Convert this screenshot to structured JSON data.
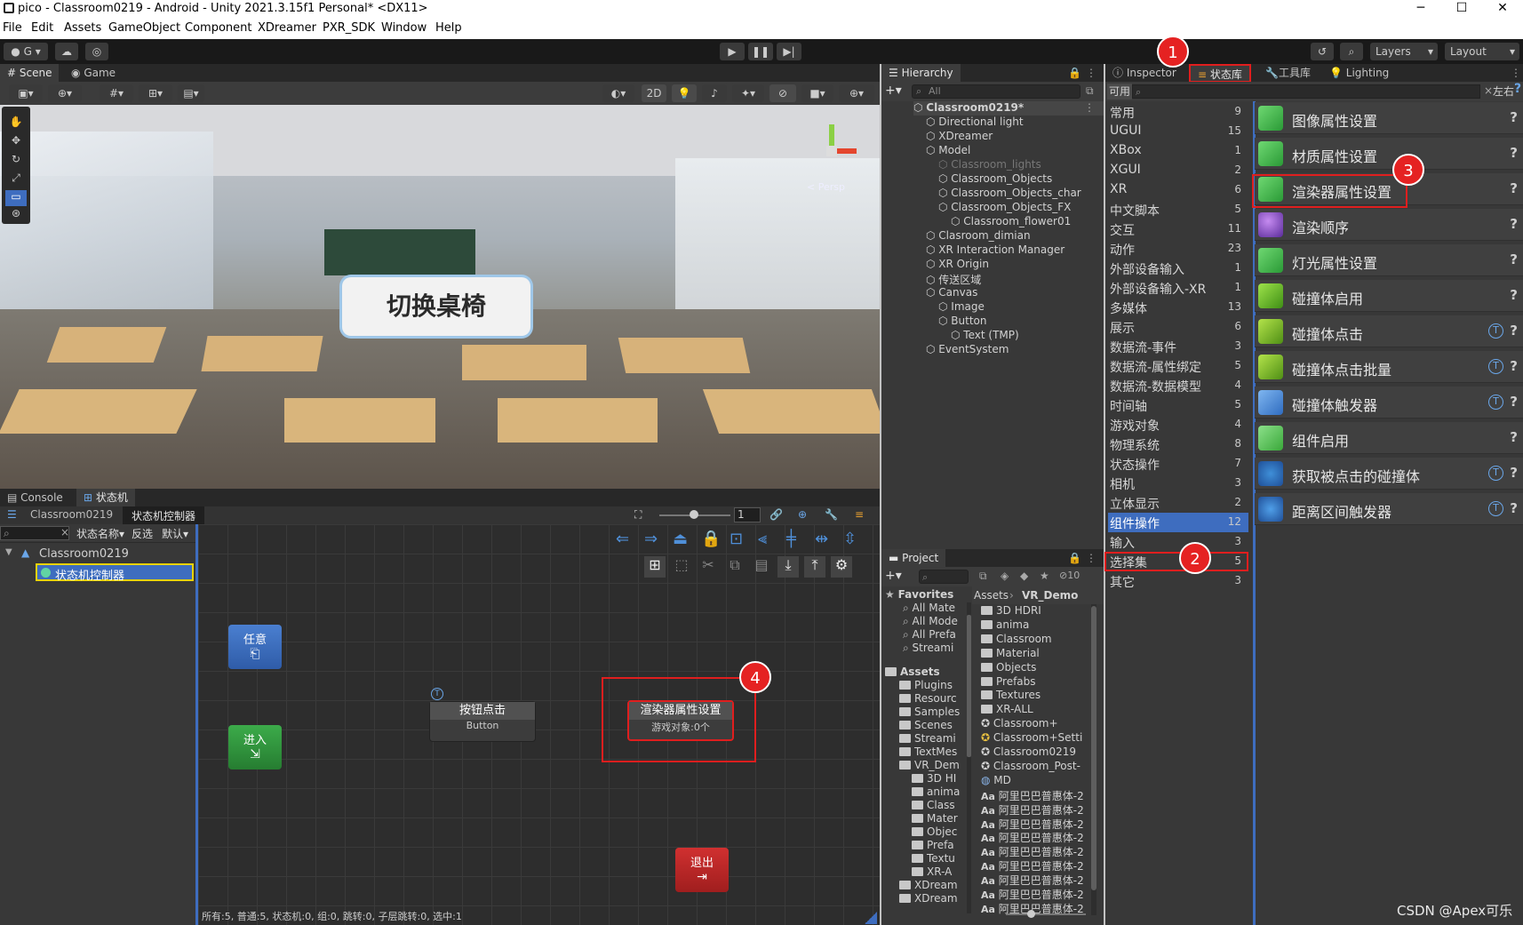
{
  "window": {
    "title": "pico - Classroom0219 - Android - Unity 2021.3.15f1 Personal* <DX11>",
    "minimize": "─",
    "maximize": "☐",
    "close": "✕"
  },
  "menu": [
    "File",
    "Edit",
    "Assets",
    "GameObject",
    "Component",
    "XDreamer",
    "PXR_SDK",
    "Window",
    "Help"
  ],
  "toolbar": {
    "account": "G",
    "layers": "Layers",
    "layout": "Layout"
  },
  "scene": {
    "tab_scene": "Scene",
    "tab_game": "Game",
    "mode_2d": "2D",
    "persp": "< Persp",
    "world_button": "切换桌椅"
  },
  "hierarchy": {
    "tab": "Hierarchy",
    "search_placeholder": "All",
    "items": [
      {
        "label": "Classroom0219*",
        "depth": 0,
        "bold": true
      },
      {
        "label": "Directional light",
        "depth": 1
      },
      {
        "label": "XDreamer",
        "depth": 1
      },
      {
        "label": "Model",
        "depth": 1
      },
      {
        "label": "Classroom_lights",
        "depth": 2,
        "dim": true
      },
      {
        "label": "Classroom_Objects",
        "depth": 2
      },
      {
        "label": "Classroom_Objects_char",
        "depth": 2
      },
      {
        "label": "Classroom_Objects_FX",
        "depth": 2
      },
      {
        "label": "Classroom_flower01",
        "depth": 3
      },
      {
        "label": "Clasroom_dimian",
        "depth": 1
      },
      {
        "label": "XR Interaction Manager",
        "depth": 1
      },
      {
        "label": "XR Origin",
        "depth": 1
      },
      {
        "label": "传送区域",
        "depth": 1
      },
      {
        "label": "Canvas",
        "depth": 1
      },
      {
        "label": "Image",
        "depth": 2
      },
      {
        "label": "Button",
        "depth": 2
      },
      {
        "label": "Text (TMP)",
        "depth": 3
      },
      {
        "label": "EventSystem",
        "depth": 1
      }
    ]
  },
  "inspector": {
    "tab_inspector": "Inspector",
    "tab_statelib": "状态库",
    "tab_tools": "工具库",
    "tab_lighting": "Lighting",
    "filter_label": "可用",
    "layout_label": "左右",
    "categories": [
      {
        "label": "常用",
        "count": "9"
      },
      {
        "label": "UGUI",
        "count": "15"
      },
      {
        "label": "XBox",
        "count": "1"
      },
      {
        "label": "XGUI",
        "count": "2"
      },
      {
        "label": "XR",
        "count": "6"
      },
      {
        "label": "中文脚本",
        "count": "5"
      },
      {
        "label": "交互",
        "count": "11"
      },
      {
        "label": "动作",
        "count": "23"
      },
      {
        "label": "外部设备输入",
        "count": "1"
      },
      {
        "label": "外部设备输入-XR",
        "count": "1"
      },
      {
        "label": "多媒体",
        "count": "13"
      },
      {
        "label": "展示",
        "count": "6"
      },
      {
        "label": "数据流-事件",
        "count": "3"
      },
      {
        "label": "数据流-属性绑定",
        "count": "5"
      },
      {
        "label": "数据流-数据模型",
        "count": "4"
      },
      {
        "label": "时间轴",
        "count": "5"
      },
      {
        "label": "游戏对象",
        "count": "4"
      },
      {
        "label": "物理系统",
        "count": "8"
      },
      {
        "label": "状态操作",
        "count": "7"
      },
      {
        "label": "相机",
        "count": "3"
      },
      {
        "label": "立体显示",
        "count": "2"
      },
      {
        "label": "组件操作",
        "count": "12",
        "selected": true
      },
      {
        "label": "输入",
        "count": "3"
      },
      {
        "label": "选择集",
        "count": "5"
      },
      {
        "label": "其它",
        "count": "3"
      }
    ],
    "components": [
      {
        "label": "图像属性设置",
        "icon": "tag-icon",
        "t": false
      },
      {
        "label": "材质属性设置",
        "icon": "tag-icon",
        "t": false
      },
      {
        "label": "渲染器属性设置",
        "icon": "tag-icon",
        "t": false
      },
      {
        "label": "渲染顺序",
        "icon": "sphere-icon",
        "t": false
      },
      {
        "label": "灯光属性设置",
        "icon": "tag-icon",
        "t": false
      },
      {
        "label": "碰撞体启用",
        "icon": "cube-icon",
        "t": false
      },
      {
        "label": "碰撞体点击",
        "icon": "cube-click-icon",
        "t": true
      },
      {
        "label": "碰撞体点击批量",
        "icon": "cube-click-icon",
        "t": true
      },
      {
        "label": "碰撞体触发器",
        "icon": "trigger-icon",
        "t": true
      },
      {
        "label": "组件启用",
        "icon": "puzzle-icon",
        "t": false
      },
      {
        "label": "获取被点击的碰撞体",
        "icon": "pointer-icon",
        "t": true
      },
      {
        "label": "距离区间触发器",
        "icon": "range-icon",
        "t": true
      }
    ],
    "help": "?",
    "t_mark": "T"
  },
  "project": {
    "tab": "Project",
    "hidden_count": "10",
    "breadcrumb": [
      "Assets",
      "VR_Demo"
    ],
    "favorites_label": "Favorites",
    "favorites": [
      "All Mate",
      "All Mode",
      "All Prefa",
      "Streami"
    ],
    "assets_label": "Assets",
    "tree": [
      "Plugins",
      "Resourc",
      "Samples",
      "Scenes",
      "Streami",
      "TextMes",
      "VR_Dem",
      "3D HI",
      "anima",
      "Class",
      "Mater",
      "Objec",
      "Prefa",
      "Textu",
      "XR-A",
      "XDream",
      "XDream"
    ],
    "files": [
      "3D HDRI",
      "anima",
      "Classroom",
      "Material",
      "Objects",
      "Prefabs",
      "Textures",
      "XR-ALL",
      "Classroom+",
      "Classroom+Setti",
      "Classroom0219",
      "Classroom_Post-",
      "MD",
      "阿里巴巴普惠体-2",
      "阿里巴巴普惠体-2",
      "阿里巴巴普惠体-2",
      "阿里巴巴普惠体-2",
      "阿里巴巴普惠体-2",
      "阿里巴巴普惠体-2",
      "阿里巴巴普惠体-2",
      "阿里巴巴普惠体-2",
      "阿里巴巴普惠体-2"
    ]
  },
  "console": {
    "tab_console": "Console",
    "tab_statemachine": "状态机"
  },
  "statemachine": {
    "breadcrumb": [
      "Classroom0219",
      "状态机控制器"
    ],
    "zoom": "1",
    "filter_label": "状态名称",
    "invert_label": "反选",
    "default_label": "默认",
    "tree_root": "Classroom0219",
    "tree_child": "状态机控制器",
    "nodes": {
      "any": "任意",
      "enter": "进入",
      "exit": "退出",
      "button_title": "按钮点击",
      "button_sub": "Button",
      "renderer_title": "渲染器属性设置",
      "renderer_sub": "游戏对象:0个"
    },
    "status": "所有:5, 普通:5, 状态机:0, 组:0, 跳转:0, 子层跳转:0, 选中:1"
  },
  "annotations": [
    "1",
    "2",
    "3",
    "4"
  ],
  "watermark": "CSDN @Apex可乐",
  "colors": {
    "accent": "#3e6dbf",
    "annotation": "#e01e1e"
  }
}
